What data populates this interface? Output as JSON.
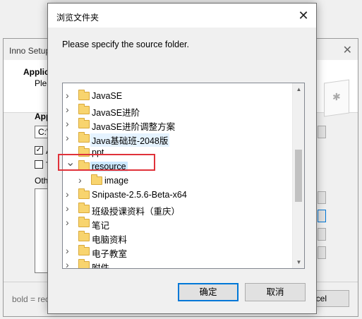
{
  "background_window": {
    "title": "Inno Setup",
    "header_title": "Applica",
    "header_subtitle": "Pleas",
    "section_label": "Appl",
    "path_value": "C:\\",
    "check1_label": "A",
    "check2_label": "T",
    "other_label": "Othe",
    "footer_text": "bold = rec",
    "cancel_label": "ncel"
  },
  "dialog": {
    "title": "浏览文件夹",
    "prompt": "Please specify the source folder.",
    "ok_label": "确定",
    "cancel_label": "取消",
    "highlight_color": "#e0323a"
  },
  "tree": {
    "items": [
      {
        "label": "JavaSE",
        "expander": "collapsed"
      },
      {
        "label": "JavaSE进阶",
        "expander": "collapsed"
      },
      {
        "label": "JavaSE进阶调整方案",
        "expander": "collapsed"
      },
      {
        "label": "Java基础班-2048版",
        "expander": "collapsed",
        "state": "hover"
      },
      {
        "label": "ppt",
        "expander": "none"
      },
      {
        "label": "resource",
        "expander": "expanded",
        "state": "selected"
      },
      {
        "label": "image",
        "expander": "collapsed",
        "indent": 1
      },
      {
        "label": "Snipaste-2.5.6-Beta-x64",
        "expander": "collapsed"
      },
      {
        "label": "班级授课资料（重庆）",
        "expander": "collapsed"
      },
      {
        "label": "笔记",
        "expander": "collapsed"
      },
      {
        "label": "电脑资料",
        "expander": "none"
      },
      {
        "label": "电子教室",
        "expander": "collapsed"
      },
      {
        "label": "附件",
        "expander": "collapsed"
      }
    ]
  }
}
